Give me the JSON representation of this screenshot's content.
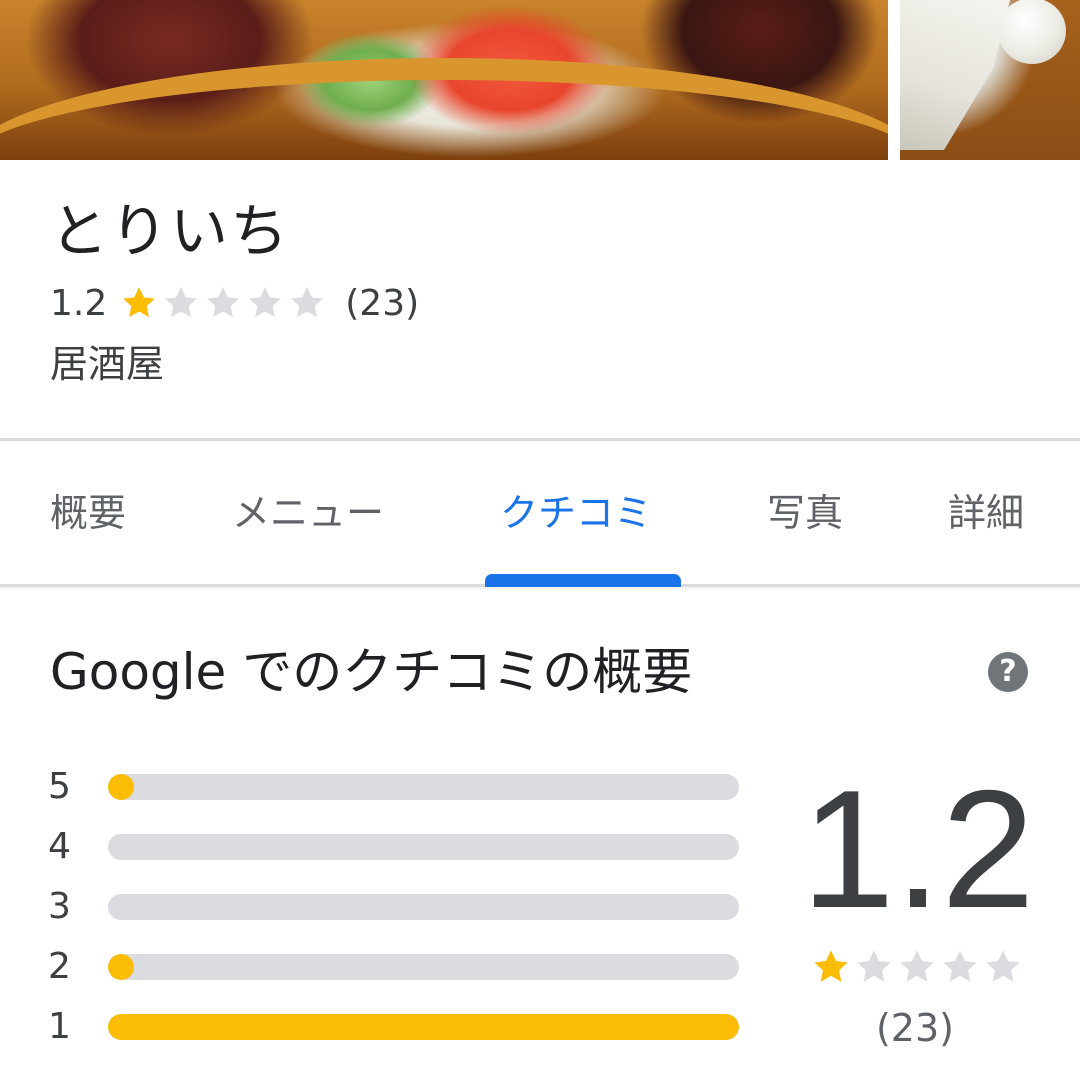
{
  "place": {
    "name": "とりいち",
    "rating": "1.2",
    "stars": 1.2,
    "review_count": "(23)",
    "category": "居酒屋"
  },
  "tabs": [
    {
      "label": "概要",
      "active": false
    },
    {
      "label": "メニュー",
      "active": false
    },
    {
      "label": "クチコミ",
      "active": true
    },
    {
      "label": "写真",
      "active": false
    },
    {
      "label": "詳細",
      "active": false
    }
  ],
  "summary": {
    "title": "Google でのクチコミの概要",
    "help_icon": "question-circle-icon",
    "distribution": [
      {
        "label": "5",
        "fraction": 0.04
      },
      {
        "label": "4",
        "fraction": 0
      },
      {
        "label": "3",
        "fraction": 0
      },
      {
        "label": "2",
        "fraction": 0.04
      },
      {
        "label": "1",
        "fraction": 1.0
      }
    ],
    "average": "1.2",
    "stars": 1.2,
    "count": "(23)"
  },
  "colors": {
    "accent": "#1a73e8",
    "star": "#fbbc04",
    "star_empty": "#dadce0",
    "bar_track": "#dadce0"
  }
}
